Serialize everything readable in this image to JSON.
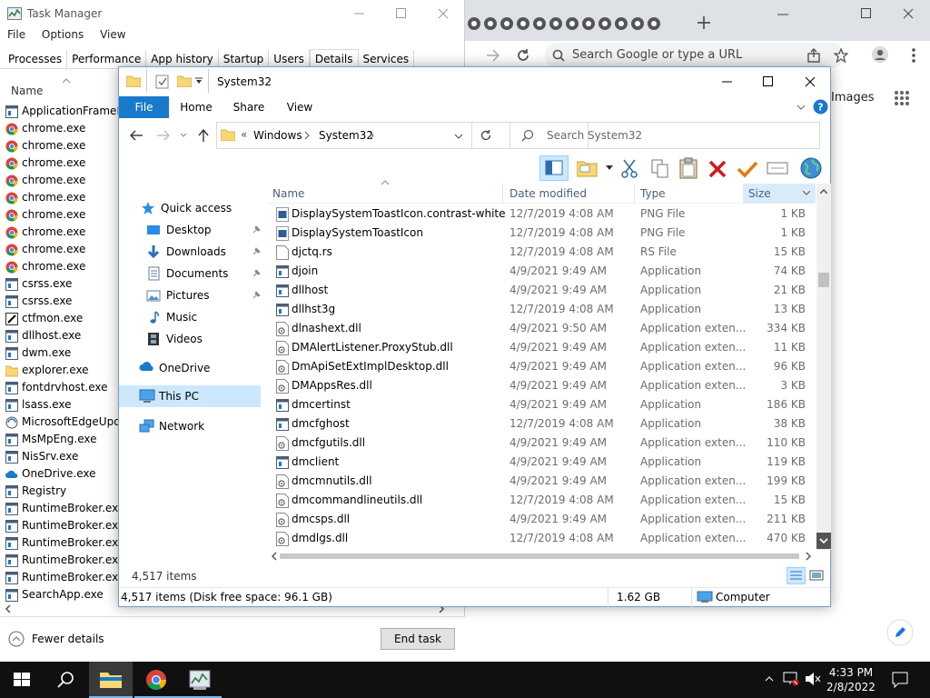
{
  "task_manager": {
    "title": "Task Manager",
    "menu": [
      "File",
      "Options",
      "View"
    ],
    "tabs": [
      {
        "label": "Processes",
        "selected": false
      },
      {
        "label": "Performance",
        "selected": false
      },
      {
        "label": "App history",
        "selected": false
      },
      {
        "label": "Startup",
        "selected": false
      },
      {
        "label": "Users",
        "selected": false
      },
      {
        "label": "Details",
        "selected": true
      },
      {
        "label": "Services",
        "selected": false
      }
    ],
    "column_header": "Name",
    "processes": [
      {
        "name": "ApplicationFrameHo",
        "icon": "app-window-icon"
      },
      {
        "name": "chrome.exe",
        "icon": "chrome-icon"
      },
      {
        "name": "chrome.exe",
        "icon": "chrome-icon"
      },
      {
        "name": "chrome.exe",
        "icon": "chrome-icon"
      },
      {
        "name": "chrome.exe",
        "icon": "chrome-icon"
      },
      {
        "name": "chrome.exe",
        "icon": "chrome-icon"
      },
      {
        "name": "chrome.exe",
        "icon": "chrome-icon"
      },
      {
        "name": "chrome.exe",
        "icon": "chrome-icon"
      },
      {
        "name": "chrome.exe",
        "icon": "chrome-icon"
      },
      {
        "name": "chrome.exe",
        "icon": "chrome-icon"
      },
      {
        "name": "csrss.exe",
        "icon": "app-window-icon"
      },
      {
        "name": "csrss.exe",
        "icon": "app-window-icon"
      },
      {
        "name": "ctfmon.exe",
        "icon": "pen-icon"
      },
      {
        "name": "dllhost.exe",
        "icon": "app-window-icon"
      },
      {
        "name": "dwm.exe",
        "icon": "app-window-icon"
      },
      {
        "name": "explorer.exe",
        "icon": "folder-icon"
      },
      {
        "name": "fontdrvhost.exe",
        "icon": "app-window-icon"
      },
      {
        "name": "lsass.exe",
        "icon": "app-window-icon"
      },
      {
        "name": "MicrosoftEdgeUpda",
        "icon": "edge-update-icon"
      },
      {
        "name": "MsMpEng.exe",
        "icon": "app-window-icon"
      },
      {
        "name": "NisSrv.exe",
        "icon": "app-window-icon"
      },
      {
        "name": "OneDrive.exe",
        "icon": "cloud-icon"
      },
      {
        "name": "Registry",
        "icon": "app-window-icon"
      },
      {
        "name": "RuntimeBroker.exe",
        "icon": "app-window-icon"
      },
      {
        "name": "RuntimeBroker.exe",
        "icon": "app-window-icon"
      },
      {
        "name": "RuntimeBroker.exe",
        "icon": "app-window-icon"
      },
      {
        "name": "RuntimeBroker.exe",
        "icon": "app-window-icon"
      },
      {
        "name": "RuntimeBroker.exe",
        "icon": "app-window-icon"
      },
      {
        "name": "SearchApp.exe",
        "icon": "app-window-icon"
      }
    ],
    "fewer_details": "Fewer details",
    "end_task": "End task"
  },
  "chrome": {
    "omnibox_placeholder": "Search Google or type a URL",
    "images_link": "Images"
  },
  "explorer": {
    "title": "System32",
    "ribbon_tabs": [
      "File",
      "Home",
      "Share",
      "View"
    ],
    "breadcrumb": [
      "Windows",
      "System32"
    ],
    "breadcrumb_prefix": "«",
    "search_placeholder": "Search System32",
    "columns": {
      "name": "Name",
      "date": "Date modified",
      "type": "Type",
      "size": "Size"
    },
    "nav": {
      "quick_access": "Quick access",
      "desktop": "Desktop",
      "downloads": "Downloads",
      "documents": "Documents",
      "pictures": "Pictures",
      "music": "Music",
      "videos": "Videos",
      "onedrive": "OneDrive",
      "this_pc": "This PC",
      "network": "Network"
    },
    "files": [
      {
        "name": "DisplaySystemToastIcon.contrast-white",
        "date": "12/7/2019 4:08 AM",
        "type": "PNG File",
        "size": "1 KB",
        "icon": "image-file-icon"
      },
      {
        "name": "DisplaySystemToastIcon",
        "date": "12/7/2019 4:08 AM",
        "type": "PNG File",
        "size": "1 KB",
        "icon": "image-file-icon"
      },
      {
        "name": "djctq.rs",
        "date": "12/7/2019 4:08 AM",
        "type": "RS File",
        "size": "15 KB",
        "icon": "blank-file-icon"
      },
      {
        "name": "djoin",
        "date": "4/9/2021 9:49 AM",
        "type": "Application",
        "size": "74 KB",
        "icon": "application-icon"
      },
      {
        "name": "dllhost",
        "date": "4/9/2021 9:49 AM",
        "type": "Application",
        "size": "21 KB",
        "icon": "application-icon"
      },
      {
        "name": "dllhst3g",
        "date": "12/7/2019 4:08 AM",
        "type": "Application",
        "size": "13 KB",
        "icon": "application-icon"
      },
      {
        "name": "dlnashext.dll",
        "date": "4/9/2021 9:50 AM",
        "type": "Application exten...",
        "size": "334 KB",
        "icon": "dll-file-icon"
      },
      {
        "name": "DMAlertListener.ProxyStub.dll",
        "date": "4/9/2021 9:49 AM",
        "type": "Application exten...",
        "size": "11 KB",
        "icon": "dll-file-icon"
      },
      {
        "name": "DmApiSetExtImplDesktop.dll",
        "date": "4/9/2021 9:49 AM",
        "type": "Application exten...",
        "size": "96 KB",
        "icon": "dll-file-icon"
      },
      {
        "name": "DMAppsRes.dll",
        "date": "4/9/2021 9:49 AM",
        "type": "Application exten...",
        "size": "3 KB",
        "icon": "dll-file-icon"
      },
      {
        "name": "dmcertinst",
        "date": "4/9/2021 9:49 AM",
        "type": "Application",
        "size": "186 KB",
        "icon": "application-icon"
      },
      {
        "name": "dmcfghost",
        "date": "12/7/2019 4:08 AM",
        "type": "Application",
        "size": "38 KB",
        "icon": "application-icon"
      },
      {
        "name": "dmcfgutils.dll",
        "date": "4/9/2021 9:49 AM",
        "type": "Application exten...",
        "size": "110 KB",
        "icon": "dll-file-icon"
      },
      {
        "name": "dmclient",
        "date": "4/9/2021 9:49 AM",
        "type": "Application",
        "size": "119 KB",
        "icon": "application-icon"
      },
      {
        "name": "dmcmnutils.dll",
        "date": "4/9/2021 9:49 AM",
        "type": "Application exten...",
        "size": "199 KB",
        "icon": "dll-file-icon"
      },
      {
        "name": "dmcommandlineutils.dll",
        "date": "12/7/2019 4:08 AM",
        "type": "Application exten...",
        "size": "15 KB",
        "icon": "dll-file-icon"
      },
      {
        "name": "dmcsps.dll",
        "date": "4/9/2021 9:49 AM",
        "type": "Application exten...",
        "size": "211 KB",
        "icon": "dll-file-icon"
      },
      {
        "name": "dmdlgs.dll",
        "date": "12/7/2019 4:08 AM",
        "type": "Application exten...",
        "size": "470 KB",
        "icon": "dll-file-icon"
      }
    ],
    "item_count": "4,517 items",
    "status_detail": "4,517 items (Disk free space: 96.1 GB)",
    "status_size": "1.62 GB",
    "status_location": "Computer"
  },
  "taskbar": {
    "time": "4:33 PM",
    "date": "2/8/2022"
  },
  "colors": {
    "accent_blue": "#1979ca",
    "selection": "#cce8ff",
    "folder_yellow": "#f8d775",
    "delete_red": "#d11a1a",
    "check_orange": "#e07a10"
  }
}
